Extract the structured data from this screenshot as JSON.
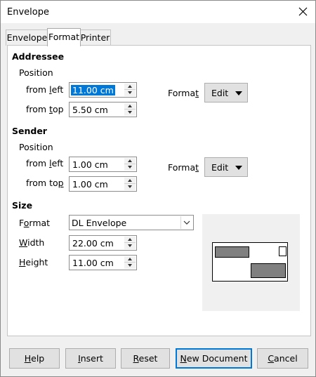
{
  "window": {
    "title": "Envelope"
  },
  "tabs": [
    {
      "label": "Envelope",
      "active": false
    },
    {
      "label": "Format",
      "active": true
    },
    {
      "label": "Printer",
      "active": false
    }
  ],
  "addressee": {
    "heading": "Addressee",
    "position_label": "Position",
    "from_left_label": "from left",
    "from_left_value": "11.00 cm",
    "from_top_label": "from top",
    "from_top_value": "5.50 cm",
    "format_label": "Format",
    "edit_label": "Edit"
  },
  "sender": {
    "heading": "Sender",
    "position_label": "Position",
    "from_left_label": "from left",
    "from_left_value": "1.00 cm",
    "from_top_label": "from top",
    "from_top_value": "1.00 cm",
    "format_label": "Format",
    "edit_label": "Edit"
  },
  "size": {
    "heading": "Size",
    "format_label": "Format",
    "format_value": "DL Envelope",
    "width_label": "Width",
    "width_value": "22.00 cm",
    "height_label": "Height",
    "height_value": "11.00 cm"
  },
  "buttons": {
    "help": "Help",
    "insert": "Insert",
    "reset": "Reset",
    "new_document": "New Document",
    "cancel": "Cancel"
  },
  "colors": {
    "selection": "#0078d7",
    "default_button_border": "#0078d7",
    "preview_block": "#808080"
  },
  "icons": {
    "close": "close-icon",
    "spin_up": "chevron-up-icon",
    "spin_down": "chevron-down-icon",
    "menu_arrow": "caret-down-icon",
    "dropdown": "chevron-down-icon"
  }
}
